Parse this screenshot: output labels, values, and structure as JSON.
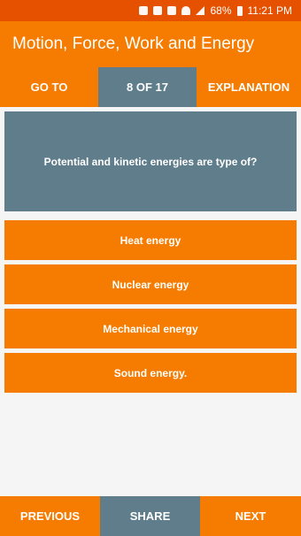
{
  "status_bar": {
    "battery_percent": "68%",
    "time": "11:21 PM",
    "icons": [
      "notification-icon",
      "file-icon",
      "image-icon",
      "wifi-icon",
      "signal-icon",
      "battery-icon"
    ]
  },
  "app_bar": {
    "title": "Motion, Force, Work and Energy"
  },
  "top_nav": {
    "goto_label": "GO TO",
    "progress_label": "8 OF 17",
    "explanation_label": "EXPLANATION"
  },
  "question": {
    "text": "Potential and kinetic energies are type of?"
  },
  "options": [
    {
      "label": "Heat energy"
    },
    {
      "label": "Nuclear energy"
    },
    {
      "label": "Mechanical energy"
    },
    {
      "label": "Sound energy."
    }
  ],
  "bottom_nav": {
    "previous_label": "PREVIOUS",
    "share_label": "SHARE",
    "next_label": "NEXT"
  },
  "colors": {
    "primary": "#f57c00",
    "primary_dark": "#e65100",
    "accent": "#607d8b",
    "background": "#f5f5f5"
  }
}
